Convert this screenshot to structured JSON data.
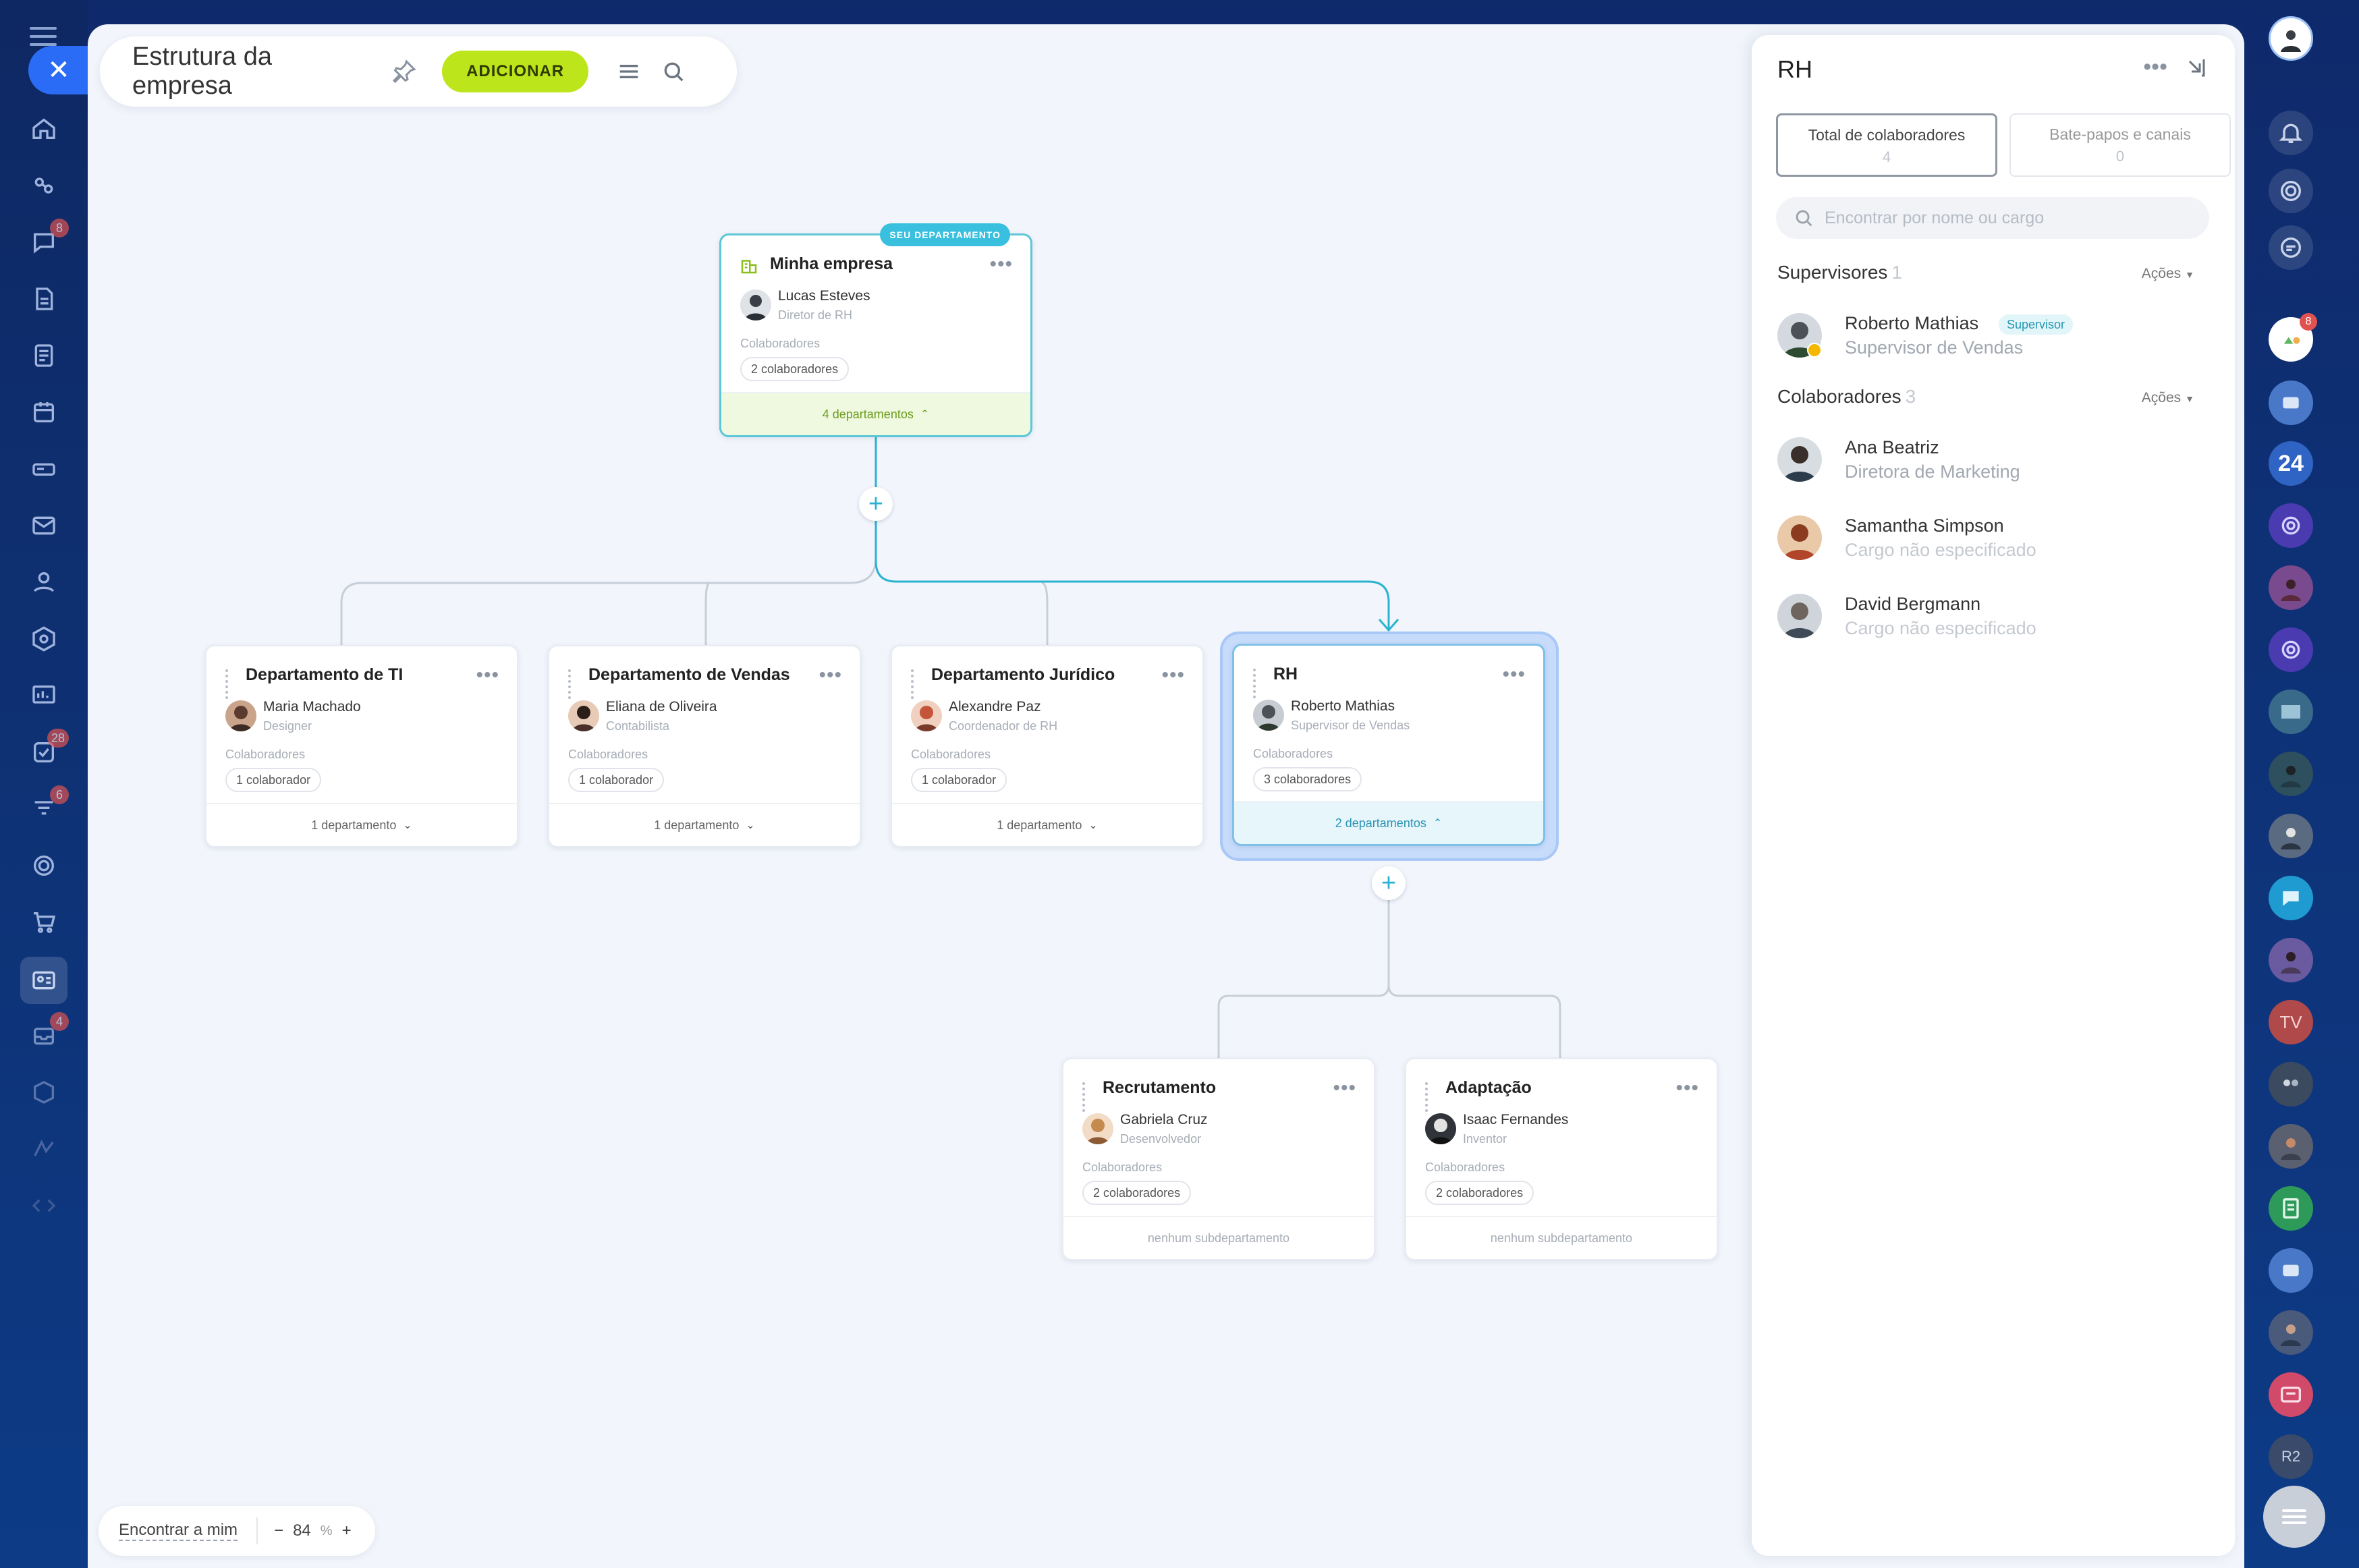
{
  "header": {
    "title": "Estrutura da empresa",
    "add_label": "ADICIONAR"
  },
  "org": {
    "root": {
      "badge": "SEU DEPARTAMENTO",
      "name": "Minha empresa",
      "head_name": "Lucas Esteves",
      "head_role": "Diretor de RH",
      "collab_label": "Colaboradores",
      "collab_count": "2 colaboradores",
      "footer": "4 departamentos"
    },
    "departments": [
      {
        "name": "Departamento de TI",
        "head_name": "Maria Machado",
        "head_role": "Designer",
        "collab_label": "Colaboradores",
        "collab_count": "1 colaborador",
        "footer": "1 departamento"
      },
      {
        "name": "Departamento de Vendas",
        "head_name": "Eliana de Oliveira",
        "head_role": "Contabilista",
        "collab_label": "Colaboradores",
        "collab_count": "1 colaborador",
        "footer": "1 departamento"
      },
      {
        "name": "Departamento Jurídico",
        "head_name": "Alexandre Paz",
        "head_role": "Coordenador de RH",
        "collab_label": "Colaboradores",
        "collab_count": "1 colaborador",
        "footer": "1 departamento"
      },
      {
        "name": "RH",
        "head_name": "Roberto Mathias",
        "head_role": "Supervisor de Vendas",
        "collab_label": "Colaboradores",
        "collab_count": "3 colaboradores",
        "footer": "2 departamentos"
      }
    ],
    "subdepartments": [
      {
        "name": "Recrutamento",
        "head_name": "Gabriela Cruz",
        "head_role": "Desenvolvedor",
        "collab_label": "Colaboradores",
        "collab_count": "2 colaboradores",
        "footer": "nenhum subdepartamento"
      },
      {
        "name": "Adaptação",
        "head_name": "Isaac Fernandes",
        "head_role": "Inventor",
        "collab_label": "Colaboradores",
        "collab_count": "2 colaboradores",
        "footer": "nenhum subdepartamento"
      }
    ]
  },
  "bottom": {
    "find_me": "Encontrar a mim",
    "zoom_minus": "−",
    "zoom_value": "84",
    "zoom_unit": "%",
    "zoom_plus": "+"
  },
  "panel": {
    "title": "RH",
    "tabs": [
      {
        "label": "Total de colaboradores",
        "value": "4"
      },
      {
        "label": "Bate-papos e canais",
        "value": "0"
      }
    ],
    "search_placeholder": "Encontrar por nome ou cargo",
    "supervisors": {
      "label": "Supervisores",
      "count": "1",
      "actions": "Ações",
      "people": [
        {
          "name": "Roberto Mathias",
          "badge": "Supervisor",
          "role": "Supervisor de Vendas"
        }
      ]
    },
    "employees": {
      "label": "Colaboradores",
      "count": "3",
      "actions": "Ações",
      "people": [
        {
          "name": "Ana Beatriz",
          "role": "Diretora de Marketing"
        },
        {
          "name": "Samantha Simpson",
          "role": "Cargo não especificado"
        },
        {
          "name": "David Bergmann",
          "role": "Cargo não especificado"
        }
      ]
    }
  },
  "left_rail": {
    "badges": {
      "chat": "8",
      "tasks": "28",
      "feed": "6",
      "mail": "4"
    }
  },
  "right_rail": {
    "badge": "8",
    "tile_24": "24",
    "tile_tv": "TV",
    "tile_r2": "R2"
  },
  "colors": {
    "accent_green": "#bde51c",
    "accent_teal": "#38c0de",
    "connector_active": "#2ab3d0",
    "connector_idle": "#c8ced8"
  }
}
